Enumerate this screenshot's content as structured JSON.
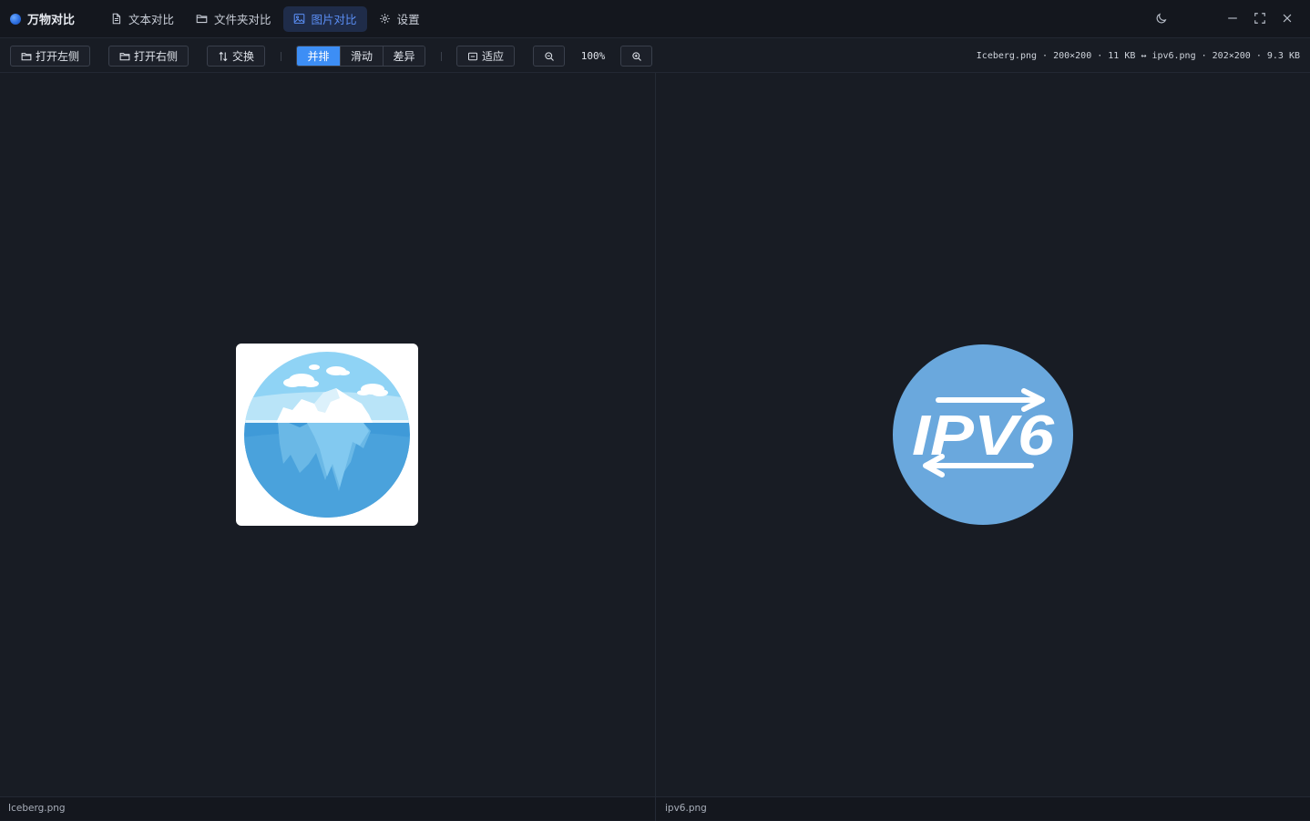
{
  "app": {
    "name": "万物对比"
  },
  "nav": {
    "tabs": [
      {
        "label": "文本对比",
        "icon": "document-icon"
      },
      {
        "label": "文件夹对比",
        "icon": "folder-icon"
      },
      {
        "label": "图片对比",
        "icon": "image-icon",
        "active": true
      },
      {
        "label": "设置",
        "icon": "gear-icon"
      }
    ]
  },
  "window": {
    "controls": [
      "moon-icon",
      "minimize-icon",
      "maximize-icon",
      "close-icon"
    ]
  },
  "toolbar": {
    "open_left": "打开左侧",
    "open_right": "打开右侧",
    "swap": "交换",
    "modes": [
      "并排",
      "滑动",
      "差异"
    ],
    "active_mode": "并排",
    "fit": "适应",
    "zoom": "100%",
    "file_info": "Iceberg.png · 200×200 · 11 KB ↔ ipv6.png · 202×200 · 9.3 KB"
  },
  "panes": {
    "left": {
      "file": "Iceberg.png"
    },
    "right": {
      "file": "ipv6.png",
      "image_text": "IPV6"
    }
  },
  "colors": {
    "accent": "#3d8ef5",
    "active_tab_bg": "#1f2c49",
    "background": "#181c24",
    "ipv6_circle": "#6aa8dd"
  }
}
